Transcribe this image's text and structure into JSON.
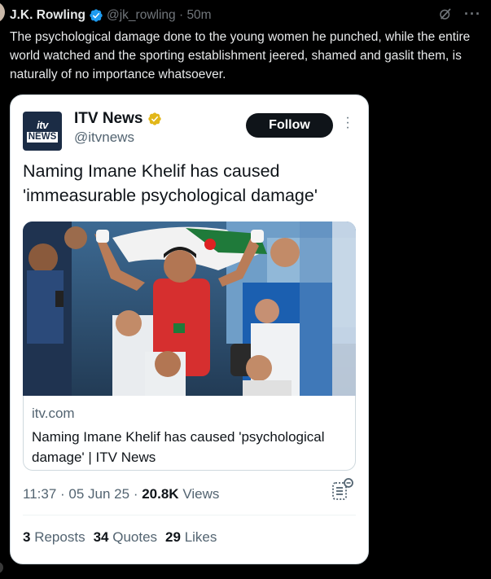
{
  "tweet": {
    "author_name": "J.K. Rowling",
    "author_handle": "@jk_rowling",
    "timestamp": "50m",
    "text": "The psychological damage done to the young women he punched, while the entire world watched and the sporting establishment jeered, shamed and gaslit them, is naturally of no importance whatsoever.",
    "verified_color": "#1d9bf0"
  },
  "quote": {
    "logo_top": "itv",
    "logo_bottom": "NEWS",
    "name": "ITV News",
    "handle": "@itvnews",
    "follow_label": "Follow",
    "headline": "Naming Imane Khelif has caused 'immeasurable psychological damage'",
    "link_domain": "itv.com",
    "link_title": "Naming Imane Khelif has caused 'psychological damage' | ITV News",
    "time": "11:37",
    "date": "05 Jun 25",
    "views_count": "20.8K",
    "views_label": "Views",
    "reposts_count": "3",
    "reposts_label": "Reposts",
    "quotes_count": "34",
    "quotes_label": "Quotes",
    "likes_count": "29",
    "likes_label": "Likes",
    "gold_badge_color": "#e2b719"
  },
  "icons": {
    "verified": "verified-badge-icon",
    "grok": "grok-icon",
    "more": "more-icon",
    "bookmark_list": "bookmark-list-icon"
  }
}
